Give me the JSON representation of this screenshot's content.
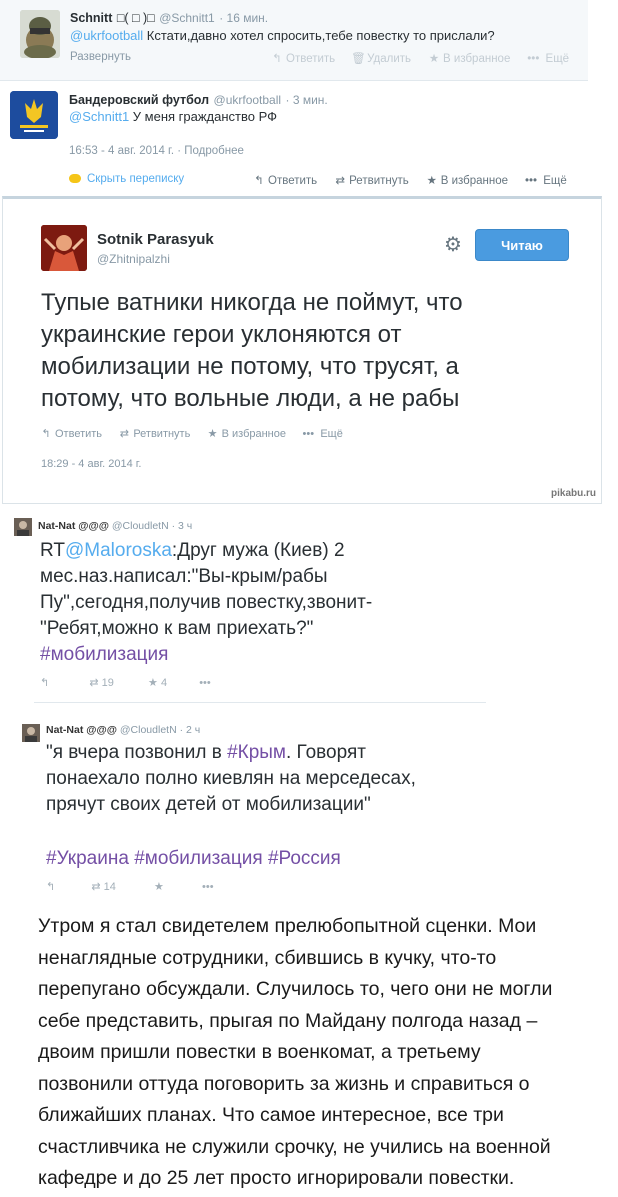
{
  "tweet1": {
    "name": "Schnitt",
    "name_suffix": "□( □ )□",
    "handle": "@Schnitt1",
    "time": "· 16 мин.",
    "mention": "@ukrfootball",
    "text": " Кстати,давно хотел спросить,тебе повестку то прислали?",
    "expand": "Развернуть",
    "actions": {
      "reply": "Ответить",
      "delete": "Удалить",
      "favorite": "В избранное",
      "more": "Ещё"
    }
  },
  "tweet2": {
    "name": "Бандеровский футбол",
    "handle": "@ukrfootball",
    "time": "· 3 мин.",
    "mention": "@Schnitt1",
    "text": " У меня гражданство РФ",
    "datetime": "16:53 - 4 авг. 2014 г.",
    "details": "· Подробнее",
    "hide": "Скрыть переписку",
    "actions": {
      "reply": "Ответить",
      "retweet": "Ретвитнуть",
      "favorite": "В избранное",
      "more": "Ещё"
    }
  },
  "tweet3": {
    "name": "Sotnik Parasyuk",
    "handle": "@Zhitnipalzhi",
    "follow": "Читаю",
    "lines": [
      "Тупые ватники никогда не поймут, что",
      "украинские герои уклоняются от",
      "мобилизации не потому, что трусят, а",
      "потому, что вольные люди, а не рабы"
    ],
    "actions": {
      "reply": "Ответить",
      "retweet": "Ретвитнуть",
      "favorite": "В избранное",
      "more": "Ещё"
    },
    "datetime": "18:29 - 4 авг. 2014 г.",
    "watermark": "pikabu.ru"
  },
  "tweet4": {
    "name": "Nat-Nat @@@",
    "handle": "@CloudletN",
    "time": "· 3 ч",
    "rt": "RT",
    "mention": "@Maloroska",
    "line1": ":Друг мужа (Киев) 2",
    "line2": "мес.наз.написал:\"Вы-крым/рабы",
    "line3": "Пу\",сегодня,получив повестку,звонит-",
    "line4": "\"Ребят,можно к вам приехать?\"",
    "hashtag": "#мобилизация",
    "retweets": "19",
    "favorites": "4"
  },
  "tweet5": {
    "name": "Nat-Nat @@@",
    "handle": "@CloudletN",
    "time": "· 2 ч",
    "line1a": "\"я вчера позвонил в ",
    "line1b": "#Крым",
    "line1c": ". Говорят",
    "line2": "понаехало полно киевлян на мерседесах,",
    "line3": "прячут своих детей от мобилизации\"",
    "tags": [
      "#Украина",
      "#мобилизация",
      "#Россия"
    ],
    "retweets": "14"
  },
  "paragraph": {
    "lines": [
      "Утром я стал свидетелем прелюбопытной сценки. Мои",
      "ненаглядные сотрудники, сбившись в кучку, что-то",
      "перепугано обсуждали. Случилось то, чего они не могли",
      "себе представить, прыгая по Майдану полгода назад –",
      "двоим пришли повестки в военкомат, а третьему",
      "позвонили оттуда поговорить за жизнь и справиться о",
      "ближайших планах. Что самое интересное, все три",
      "счастливчика не служили срочку, не учились на военной",
      "кафедре и до 25 лет просто игнорировали повестки."
    ]
  },
  "colors": {
    "link": "#55acee",
    "hashtag": "#744fa5",
    "follow_button": "#4a9be0",
    "gray": "#8899a6"
  }
}
